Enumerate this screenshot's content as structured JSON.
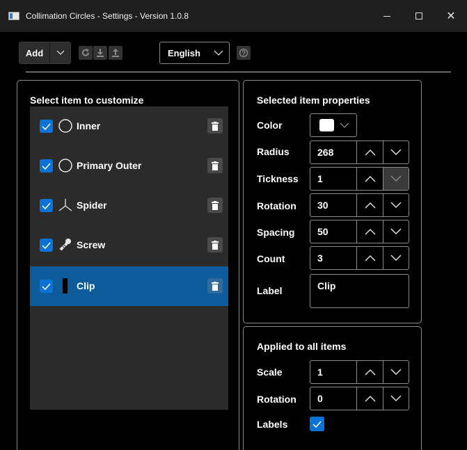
{
  "window": {
    "title": "Collimation Circles - Settings - Version 1.0.8",
    "min_glyph": "",
    "close_glyph": "✕"
  },
  "toolbar": {
    "add_label": "Add",
    "language": "English",
    "icons": [
      "chevron-down-icon",
      "refresh-icon",
      "download-icon",
      "upload-icon",
      "help-icon"
    ]
  },
  "left": {
    "title": "Select item to customize",
    "items": [
      {
        "label": "Inner",
        "icon": "circle-icon",
        "checked": true,
        "selected": false
      },
      {
        "label": "Primary Outer",
        "icon": "circle-icon",
        "checked": true,
        "selected": false
      },
      {
        "label": "Spider",
        "icon": "spider-icon",
        "checked": true,
        "selected": false
      },
      {
        "label": "Screw",
        "icon": "screw-icon",
        "checked": true,
        "selected": false
      },
      {
        "label": "Clip",
        "icon": "clip-icon",
        "checked": true,
        "selected": true
      }
    ]
  },
  "props": {
    "title": "Selected item properties",
    "color_label": "Color",
    "color_value": "#ffffff",
    "radius_label": "Radius",
    "radius_value": "268",
    "thickness_label": "Tickness",
    "thickness_value": "1",
    "rotation_label": "Rotation",
    "rotation_value": "30",
    "spacing_label": "Spacing",
    "spacing_value": "50",
    "count_label": "Count",
    "count_value": "3",
    "label_label": "Label",
    "label_value": "Clip"
  },
  "all": {
    "title": "Applied to all items",
    "scale_label": "Scale",
    "scale_value": "1",
    "rotation_label": "Rotation",
    "rotation_value": "0",
    "labels_label": "Labels",
    "labels_checked": true
  },
  "colors": {
    "accent": "#0b72d6",
    "selection": "#0e5b9b",
    "list_bg": "#2b2b2b"
  }
}
